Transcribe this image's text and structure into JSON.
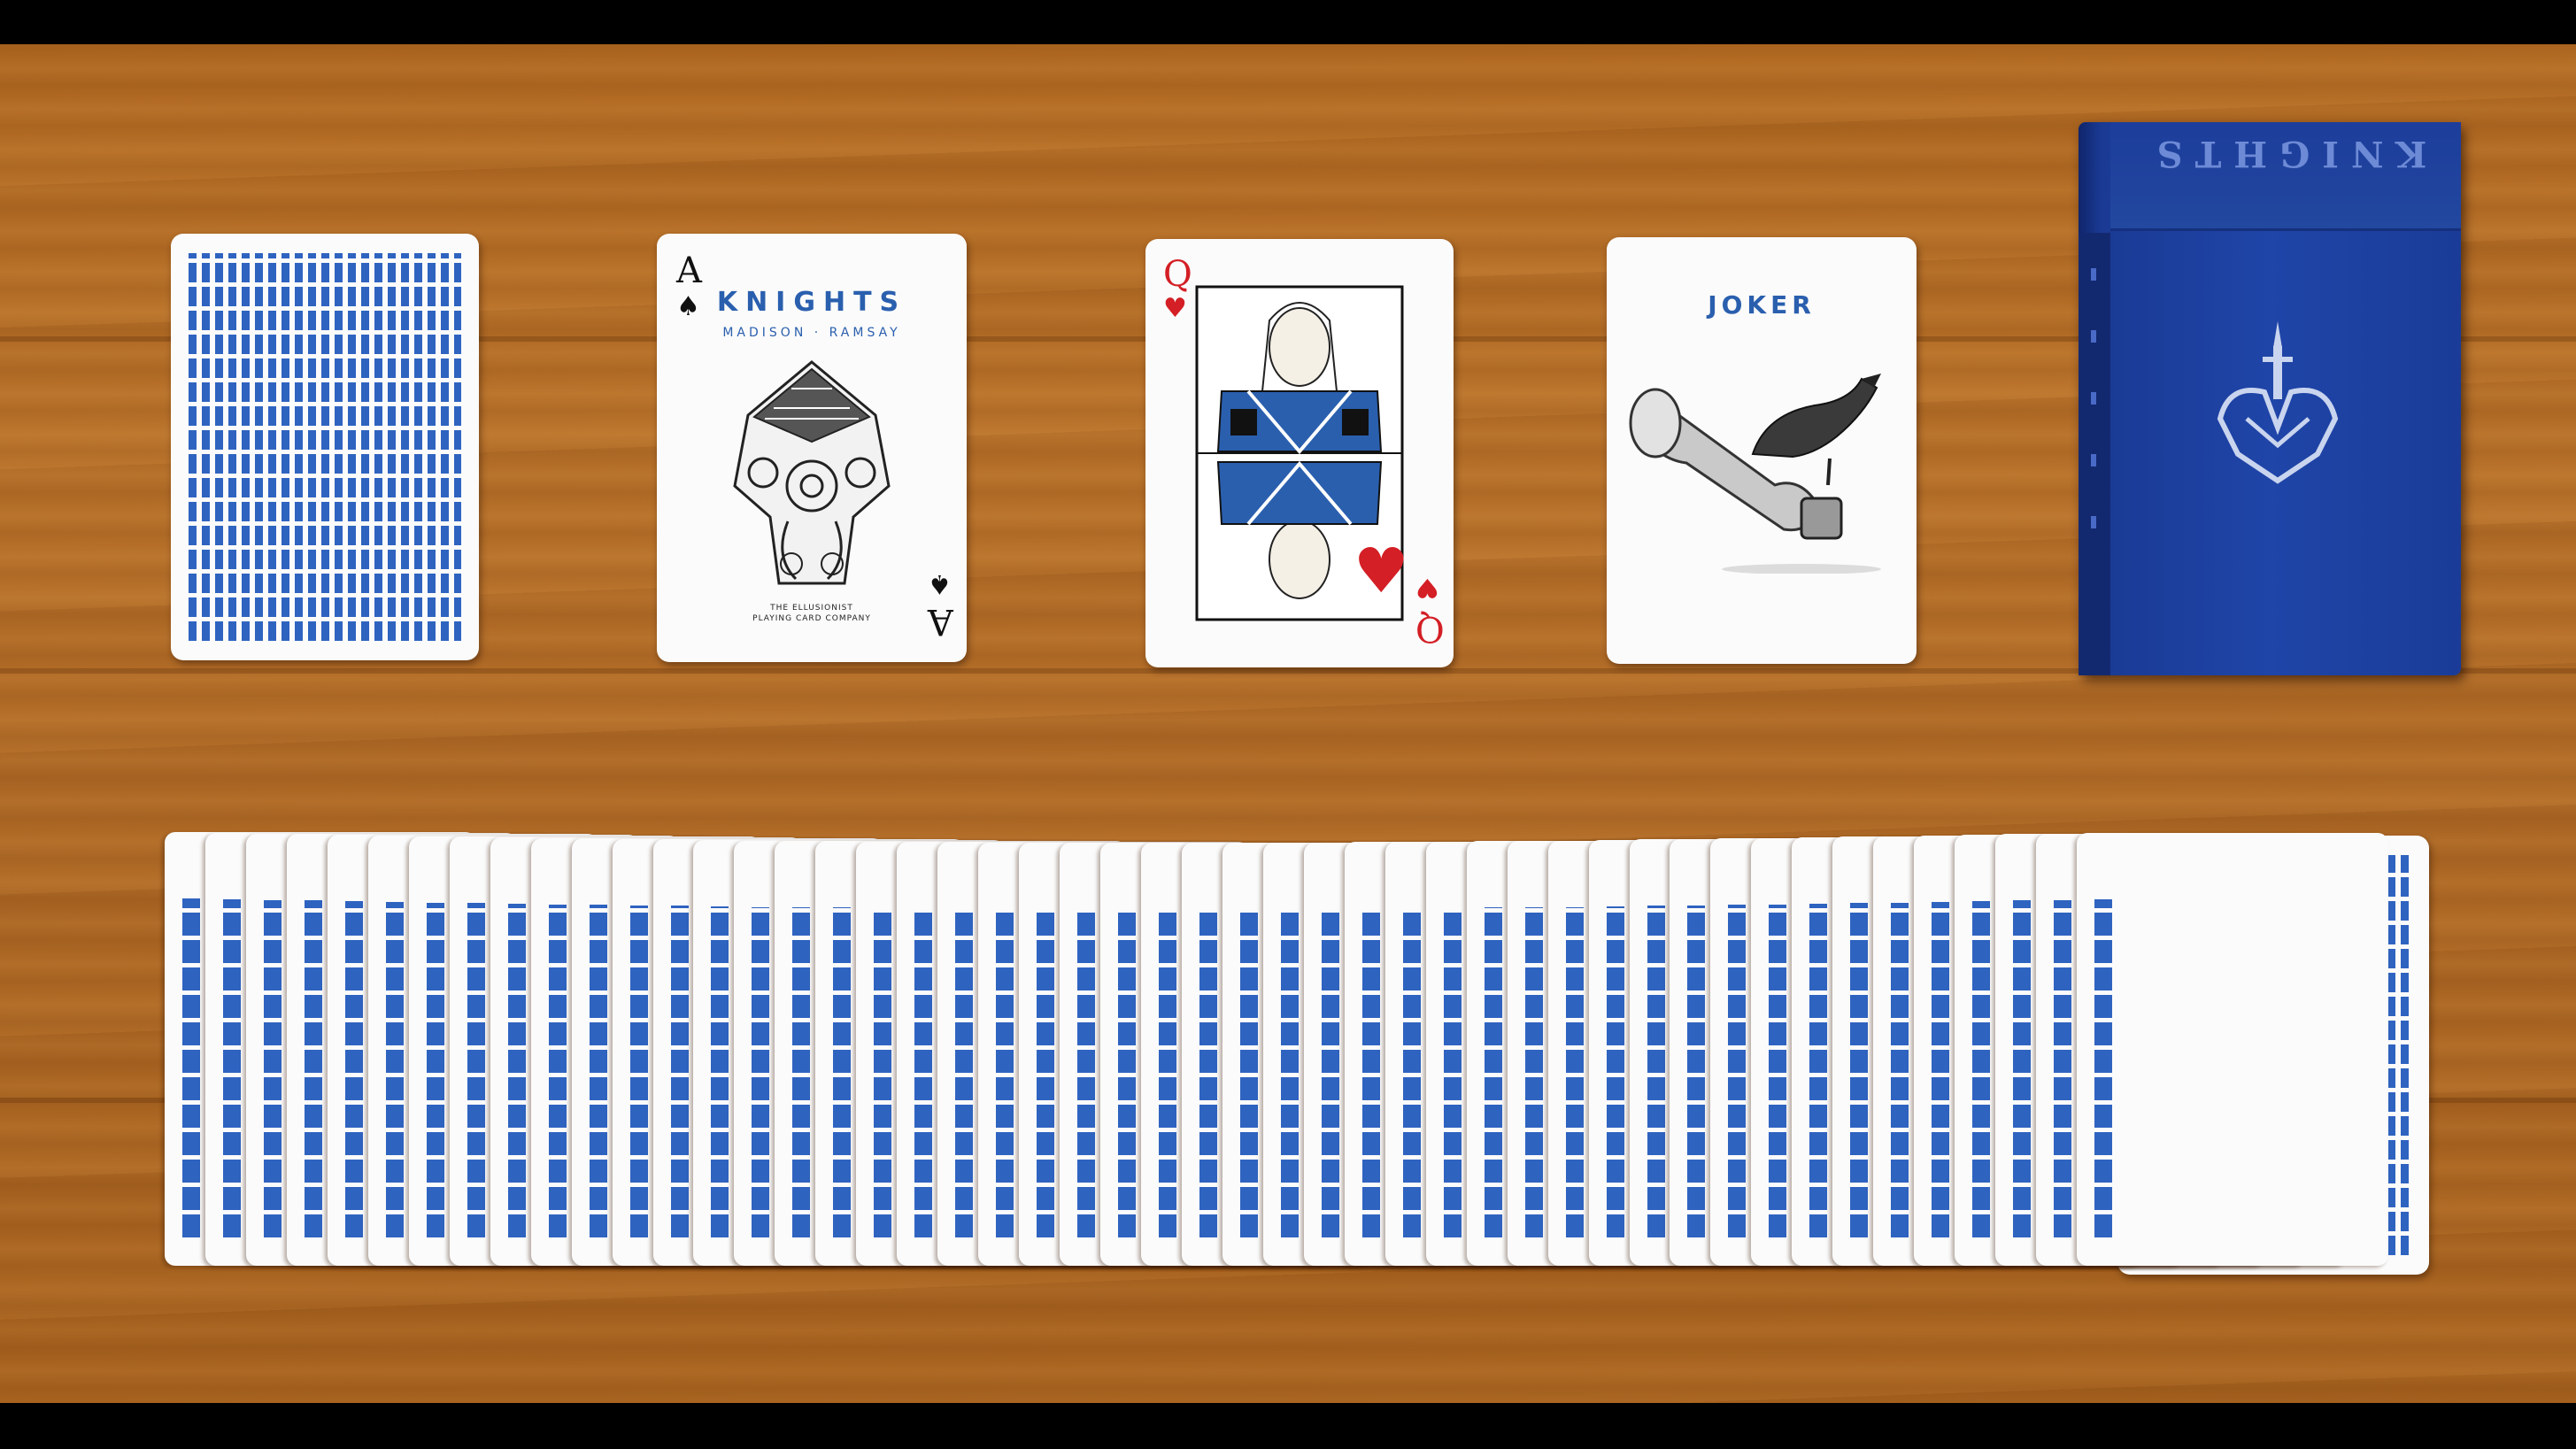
{
  "scene": {
    "description_colors": {
      "table": "#b26a22",
      "card_blue": "#2f63c0",
      "box_blue": "#1f45a8",
      "suit_red": "#d31f25"
    }
  },
  "ace_card": {
    "rank": "A",
    "suit": "♠",
    "brand": "KNIGHTS",
    "subtitle": "MADISON · RAMSAY",
    "footer_line1": "THE ELLUSIONIST",
    "footer_line2": "PLAYING CARD COMPANY"
  },
  "queen_card": {
    "rank": "Q",
    "suit": "♥"
  },
  "joker_card": {
    "title": "JOKER"
  },
  "card_box": {
    "title": "KNIGHTS"
  },
  "fan": {
    "card_count": 48
  }
}
